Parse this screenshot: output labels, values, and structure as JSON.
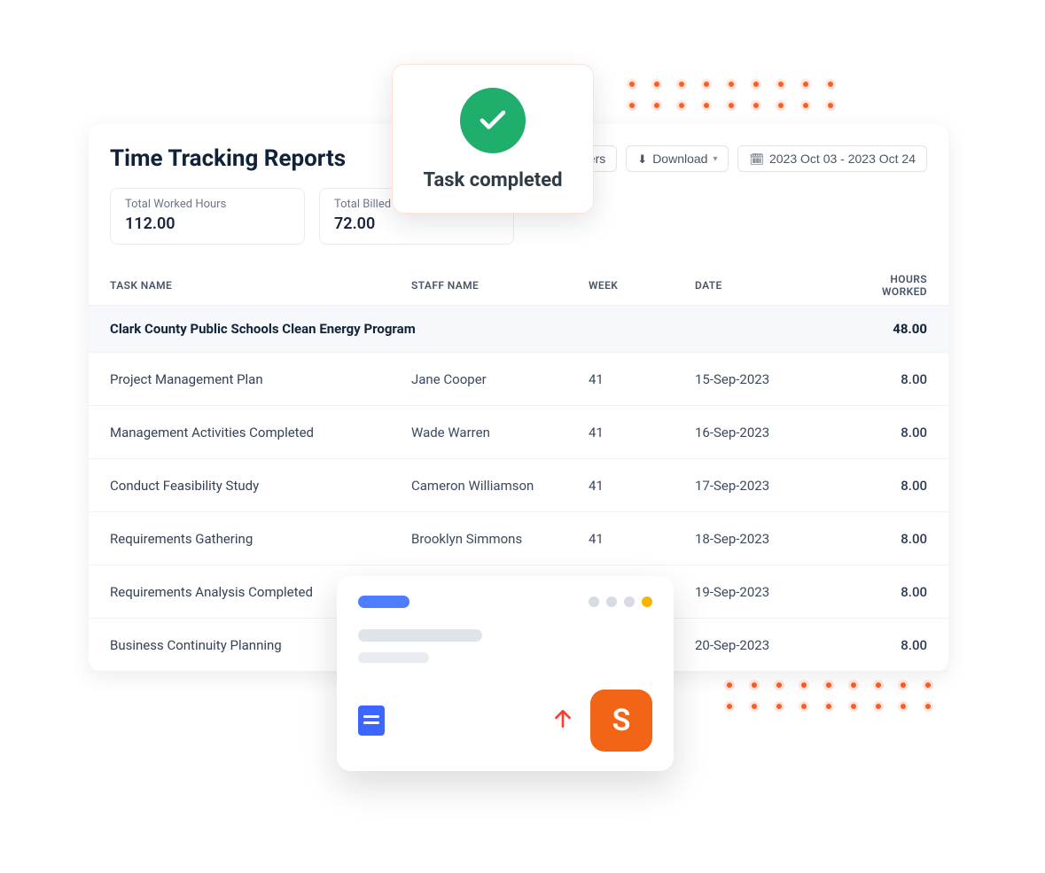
{
  "page_title": "Time Tracking Reports",
  "toolbar": {
    "filters_label": "ilters",
    "download_label": "Download",
    "date_range": "2023 Oct 03 - 2023 Oct 24"
  },
  "stats": [
    {
      "label": "Total Worked Hours",
      "value": "112.00"
    },
    {
      "label": "Total Billed",
      "value": "72.00"
    }
  ],
  "table": {
    "headers": {
      "task": "TASK NAME",
      "staff": "STAFF NAME",
      "week": "WEEK",
      "date": "DATE",
      "hours": "HOURS WORKED"
    },
    "group": {
      "name": "Clark County Public Schools Clean Energy Program",
      "hours": "48.00"
    },
    "rows": [
      {
        "task": "Project Management Plan",
        "staff": "Jane Cooper",
        "week": "41",
        "date": "15-Sep-2023",
        "hours": "8.00"
      },
      {
        "task": "Management Activities Completed",
        "staff": "Wade Warren",
        "week": "41",
        "date": "16-Sep-2023",
        "hours": "8.00"
      },
      {
        "task": "Conduct Feasibility Study",
        "staff": "Cameron Williamson",
        "week": "41",
        "date": "17-Sep-2023",
        "hours": "8.00"
      },
      {
        "task": "Requirements Gathering",
        "staff": "Brooklyn Simmons",
        "week": "41",
        "date": "18-Sep-2023",
        "hours": "8.00"
      },
      {
        "task": "Requirements Analysis Completed",
        "staff": "",
        "week": "",
        "date": "19-Sep-2023",
        "hours": "8.00"
      },
      {
        "task": "Business Continuity Planning",
        "staff": "",
        "week": "",
        "date": "20-Sep-2023",
        "hours": "8.00"
      }
    ]
  },
  "toast": {
    "message": "Task completed"
  },
  "mini_card": {
    "badge_letter": "S"
  }
}
